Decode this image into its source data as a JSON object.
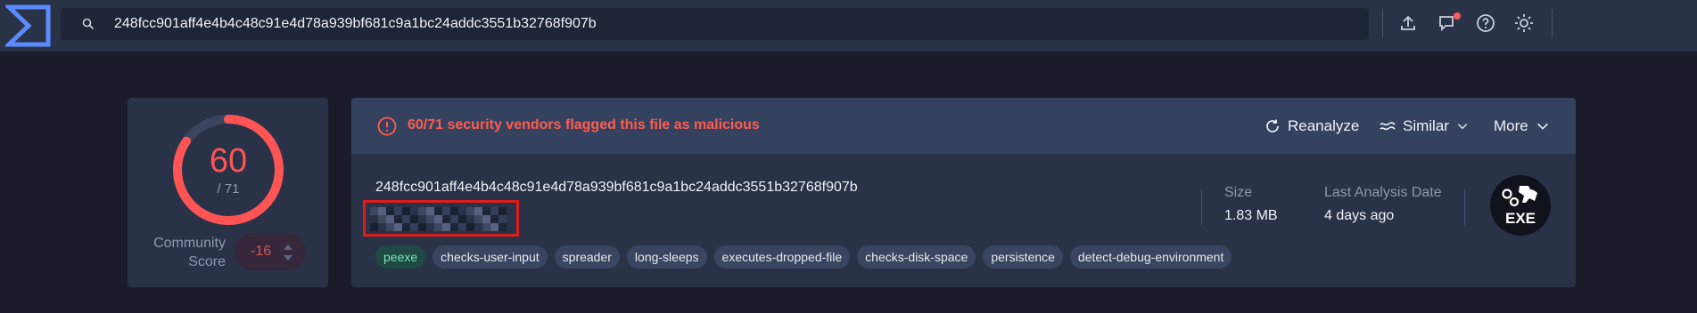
{
  "topbar": {
    "search_value": "248fcc901aff4e4b4c48c91e4d78a939bf681c9a1bc24addc3551b32768f907b",
    "icons": [
      "upload-icon",
      "comment-icon",
      "help-icon",
      "theme-icon"
    ]
  },
  "detection": {
    "positives": "60",
    "total": "/ 71",
    "community_label": "Community Score",
    "community_score": "-16"
  },
  "alert": {
    "text": "60/71 security vendors flagged this file as malicious",
    "reanalyze": "Reanalyze",
    "similar": "Similar",
    "more": "More"
  },
  "file": {
    "hash": "248fcc901aff4e4b4c48c91e4d78a939bf681c9a1bc24addc3551b32768f907b",
    "tags": [
      "peexe",
      "checks-user-input",
      "spreader",
      "long-sleeps",
      "executes-dropped-file",
      "checks-disk-space",
      "persistence",
      "detect-debug-environment"
    ],
    "size_label": "Size",
    "size_value": "1.83 MB",
    "date_label": "Last Analysis Date",
    "date_value": "4 days ago",
    "type_icon_text": "EXE"
  },
  "colors": {
    "danger": "#ff5454",
    "accent": "#5b8cff",
    "topbar": "#2a3248",
    "card": "#2a3248"
  }
}
